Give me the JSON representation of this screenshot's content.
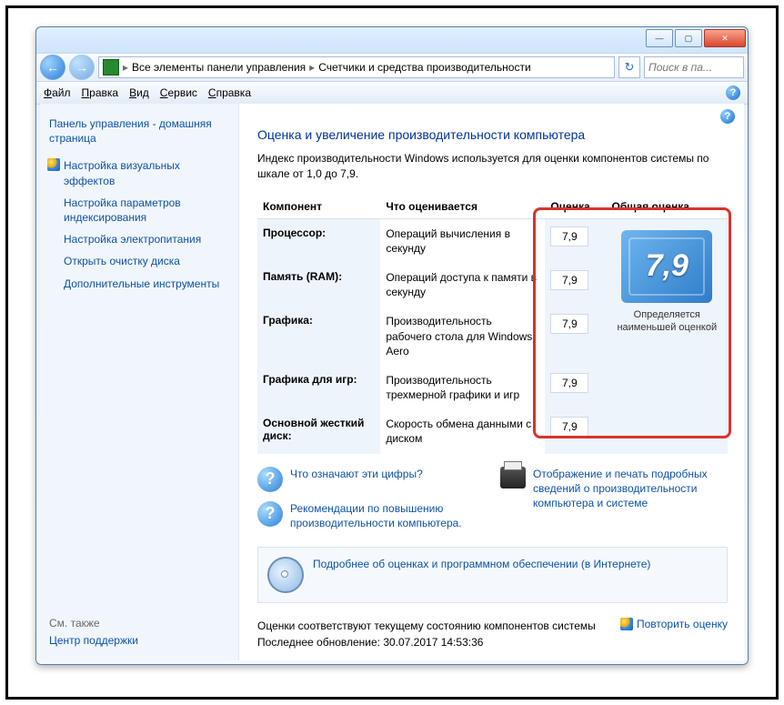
{
  "breadcrumb": {
    "seg1": "Все элементы панели управления",
    "seg2": "Счетчики и средства производительности"
  },
  "search": {
    "placeholder": "Поиск в па..."
  },
  "menu": {
    "file": "Файл",
    "edit": "Правка",
    "view": "Вид",
    "tools": "Сервис",
    "help": "Справка"
  },
  "sidebar": {
    "home": "Панель управления - домашняя страница",
    "items": [
      "Настройка визуальных эффектов",
      "Настройка параметров индексирования",
      "Настройка электропитания",
      "Открыть очистку диска",
      "Дополнительные инструменты"
    ],
    "seealso_hdr": "См. также",
    "seealso_link": "Центр поддержки"
  },
  "main": {
    "title": "Оценка и увеличение производительности компьютера",
    "intro": "Индекс производительности Windows используется для оценки компонентов системы по шкале от 1,0 до 7,9.",
    "hdr_component": "Компонент",
    "hdr_what": "Что оценивается",
    "hdr_score": "Оценка",
    "hdr_base": "Общая оценка",
    "rows": [
      {
        "name": "Процессор:",
        "desc": "Операций вычисления в секунду",
        "score": "7,9"
      },
      {
        "name": "Память (RAM):",
        "desc": "Операций доступа к памяти в секунду",
        "score": "7,9"
      },
      {
        "name": "Графика:",
        "desc": "Производительность рабочего стола для Windows Aero",
        "score": "7,9"
      },
      {
        "name": "Графика для игр:",
        "desc": "Производительность трехмерной графики и игр",
        "score": "7,9"
      },
      {
        "name": "Основной жесткий диск:",
        "desc": "Скорость обмена данными с диском",
        "score": "7,9"
      }
    ],
    "base_score": "7,9",
    "base_caption": "Определяется наименьшей оценкой",
    "link_whatnumbers": "Что означают эти цифры?",
    "link_printdetails": "Отображение и печать подробных сведений о производительности компьютера и системе",
    "link_tips": "Рекомендации по повышению производительности компьютера.",
    "link_learnmore": "Подробнее об оценках и программном обеспечении (в Интернете)",
    "status_line1": "Оценки соответствуют текущему состоянию компонентов системы",
    "status_line2": "Последнее обновление: 30.07.2017 14:53:36",
    "rerun": "Повторить оценку"
  }
}
